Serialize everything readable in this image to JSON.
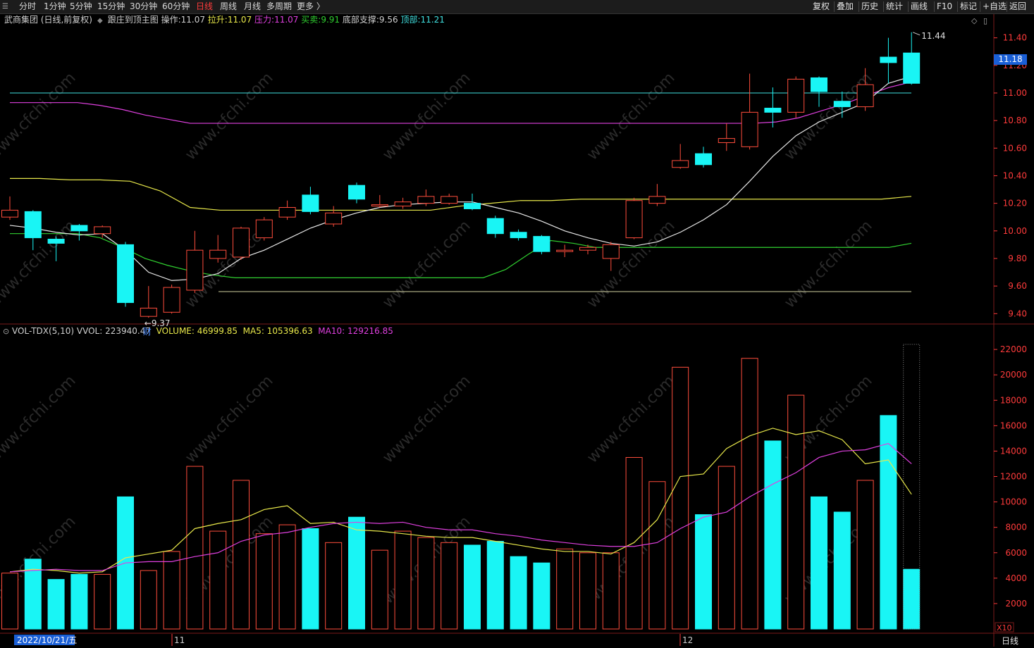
{
  "toolbar": {
    "app_icon": "menu-icon",
    "periods": [
      {
        "label": "分时"
      },
      {
        "label": "1分钟"
      },
      {
        "label": "5分钟"
      },
      {
        "label": "15分钟"
      },
      {
        "label": "30分钟"
      },
      {
        "label": "60分钟"
      },
      {
        "label": "日线",
        "active": true
      },
      {
        "label": "周线"
      },
      {
        "label": "月线"
      },
      {
        "label": "多周期"
      },
      {
        "label": "更多 〉"
      }
    ],
    "right_buttons": [
      {
        "label": "复权"
      },
      {
        "label": "叠加"
      },
      {
        "label": "历史"
      },
      {
        "label": "统计"
      },
      {
        "label": "画线"
      },
      {
        "label": "F10"
      },
      {
        "label": "标记"
      },
      {
        "label": "+自选"
      },
      {
        "label": "返回"
      }
    ]
  },
  "main_info": {
    "stock": "武商集团 (日线,前复权)",
    "indicator": "跟庄到顶主图",
    "op_label": "操作:",
    "op_value": "11.07",
    "lashen_label": "拉升:",
    "lashen_value": "11.07",
    "yali_label": "压力:",
    "yali_value": "11.07",
    "maimai_label": "买卖:",
    "maimai_value": "9.91",
    "dibu_label": "底部支撑:",
    "dibu_value": "9.56",
    "dingbu_label": "顶部:",
    "dingbu_value": "11.21"
  },
  "vol_info": {
    "name": "VOL-TDX(5,10)",
    "vvol": "VVOL: 223940.47",
    "volume": "VOLUME: 46999.85",
    "ma5": "MA5: 105396.63",
    "ma10": "MA10: 129216.85"
  },
  "price_axis": {
    "ticks": [
      "11.40",
      "11.20",
      "11.00",
      "10.80",
      "10.60",
      "10.40",
      "10.20",
      "10.00",
      "9.80",
      "9.60",
      "9.40"
    ],
    "current": "11.18"
  },
  "vol_axis": {
    "ticks": [
      "22000",
      "20000",
      "18000",
      "16000",
      "14000",
      "12000",
      "10000",
      "8000",
      "6000",
      "4000",
      "2000"
    ],
    "unit": "X10"
  },
  "annotations": {
    "high": "11.44",
    "low": "9.37",
    "cai": "财"
  },
  "date_bar": {
    "date": "2022/10/21/五",
    "month1": "11",
    "month2": "12",
    "period": "日线"
  },
  "watermark": "www.cfchi.com",
  "colors": {
    "up": "#ff4d3c",
    "down": "#19f5f5",
    "ma_white": "#e8e8e8",
    "yellow": "#e8e84a",
    "magenta": "#e040e0",
    "green": "#30d030",
    "cyan_line": "#40e0e0",
    "axis_red": "#ff3b3b"
  },
  "chart_data": {
    "type": "candlestick",
    "candles": [
      {
        "o": 10.1,
        "c": 10.15,
        "h": 10.25,
        "l": 10.08
      },
      {
        "o": 10.14,
        "c": 9.95,
        "h": 10.15,
        "l": 9.86
      },
      {
        "o": 9.94,
        "c": 9.91,
        "h": 9.96,
        "l": 9.78
      },
      {
        "o": 10.04,
        "c": 10.0,
        "h": 10.05,
        "l": 9.93
      },
      {
        "o": 9.98,
        "c": 10.03,
        "h": 10.04,
        "l": 9.95
      },
      {
        "o": 9.9,
        "c": 9.48,
        "h": 9.92,
        "l": 9.45
      },
      {
        "o": 9.38,
        "c": 9.44,
        "h": 9.6,
        "l": 9.37
      },
      {
        "o": 9.41,
        "c": 9.59,
        "h": 9.61,
        "l": 9.4
      },
      {
        "o": 9.57,
        "c": 9.86,
        "h": 10.0,
        "l": 9.55
      },
      {
        "o": 9.8,
        "c": 9.86,
        "h": 9.97,
        "l": 9.77
      },
      {
        "o": 9.81,
        "c": 10.02,
        "h": 10.03,
        "l": 9.79
      },
      {
        "o": 9.95,
        "c": 10.08,
        "h": 10.1,
        "l": 9.93
      },
      {
        "o": 10.1,
        "c": 10.17,
        "h": 10.22,
        "l": 10.08
      },
      {
        "o": 10.26,
        "c": 10.14,
        "h": 10.32,
        "l": 10.12
      },
      {
        "o": 10.05,
        "c": 10.13,
        "h": 10.18,
        "l": 10.03
      },
      {
        "o": 10.33,
        "c": 10.23,
        "h": 10.35,
        "l": 10.2
      },
      {
        "o": 10.18,
        "c": 10.19,
        "h": 10.26,
        "l": 10.17
      },
      {
        "o": 10.18,
        "c": 10.21,
        "h": 10.24,
        "l": 10.16
      },
      {
        "o": 10.2,
        "c": 10.25,
        "h": 10.3,
        "l": 10.18
      },
      {
        "o": 10.2,
        "c": 10.25,
        "h": 10.27,
        "l": 10.19
      },
      {
        "o": 10.2,
        "c": 10.16,
        "h": 10.27,
        "l": 10.15
      },
      {
        "o": 10.09,
        "c": 9.98,
        "h": 10.11,
        "l": 9.95
      },
      {
        "o": 9.99,
        "c": 9.95,
        "h": 10.01,
        "l": 9.93
      },
      {
        "o": 9.96,
        "c": 9.85,
        "h": 9.97,
        "l": 9.83
      },
      {
        "o": 9.85,
        "c": 9.86,
        "h": 9.9,
        "l": 9.81
      },
      {
        "o": 9.86,
        "c": 9.88,
        "h": 9.9,
        "l": 9.83
      },
      {
        "o": 9.8,
        "c": 9.9,
        "h": 9.92,
        "l": 9.71
      },
      {
        "o": 9.95,
        "c": 10.22,
        "h": 10.24,
        "l": 9.94
      },
      {
        "o": 10.2,
        "c": 10.25,
        "h": 10.34,
        "l": 10.18
      },
      {
        "o": 10.46,
        "c": 10.51,
        "h": 10.63,
        "l": 10.45
      },
      {
        "o": 10.56,
        "c": 10.48,
        "h": 10.61,
        "l": 10.46
      },
      {
        "o": 10.64,
        "c": 10.67,
        "h": 10.78,
        "l": 10.58
      },
      {
        "o": 10.61,
        "c": 10.86,
        "h": 11.14,
        "l": 10.59
      },
      {
        "o": 10.89,
        "c": 10.86,
        "h": 11.04,
        "l": 10.75
      },
      {
        "o": 10.86,
        "c": 11.1,
        "h": 11.12,
        "l": 10.82
      },
      {
        "o": 11.11,
        "c": 11.01,
        "h": 11.12,
        "l": 10.9
      },
      {
        "o": 10.94,
        "c": 10.9,
        "h": 11.01,
        "l": 10.82
      },
      {
        "o": 10.9,
        "c": 11.06,
        "h": 11.18,
        "l": 10.87
      },
      {
        "o": 11.26,
        "c": 11.22,
        "h": 11.4,
        "l": 11.07
      },
      {
        "o": 11.29,
        "c": 11.07,
        "h": 11.44,
        "l": 11.06
      }
    ],
    "volume": [
      4400,
      5500,
      3900,
      4300,
      4300,
      10400,
      4600,
      6100,
      12800,
      7700,
      11700,
      7500,
      8200,
      7900,
      6800,
      8800,
      6200,
      7700,
      7200,
      6800,
      6600,
      6900,
      5700,
      5200,
      6300,
      6000,
      6000,
      13500,
      11600,
      20600,
      9000,
      12800,
      21300,
      14800,
      18400,
      10400,
      9200,
      11700,
      16800,
      4700
    ],
    "volume_max_bar": 22400,
    "ma_price_white": [
      10.04,
      10.02,
      9.99,
      9.97,
      9.98,
      9.86,
      9.7,
      9.64,
      9.65,
      9.69,
      9.8,
      9.86,
      9.94,
      10.02,
      10.08,
      10.13,
      10.17,
      10.19,
      10.2,
      10.21,
      10.21,
      10.17,
      10.13,
      10.07,
      10.0,
      9.95,
      9.91,
      9.89,
      9.92,
      9.99,
      10.08,
      10.19,
      10.36,
      10.54,
      10.69,
      10.79,
      10.86,
      10.93,
      11.07,
      11.12
    ],
    "line_yellow": [
      10.38,
      10.38,
      10.37,
      10.37,
      10.36,
      10.29,
      10.17,
      10.15,
      10.15,
      10.15,
      10.15,
      10.15,
      10.15,
      10.15,
      10.15,
      10.18,
      10.2,
      10.22,
      10.22,
      10.23,
      10.23,
      10.23,
      10.23,
      10.23,
      10.23,
      10.23,
      10.23,
      10.23,
      10.23,
      10.23,
      10.25
    ],
    "line_magenta": [
      10.93,
      10.93,
      10.93,
      10.93,
      10.91,
      10.88,
      10.84,
      10.81,
      10.78,
      10.78,
      10.78,
      10.78,
      10.78,
      10.78,
      10.78,
      10.78,
      10.78,
      10.78,
      10.78,
      10.78,
      10.78,
      10.78,
      10.78,
      10.78,
      10.78,
      10.78,
      10.78,
      10.78,
      10.78,
      10.78,
      10.78,
      10.78,
      10.78,
      10.78,
      10.79,
      10.82,
      10.87,
      10.92,
      10.98,
      11.04,
      11.08
    ],
    "line_green": [
      9.98,
      9.98,
      9.98,
      9.98,
      9.95,
      9.88,
      9.8,
      9.75,
      9.71,
      9.68,
      9.66,
      9.66,
      9.66,
      9.66,
      9.66,
      9.66,
      9.66,
      9.66,
      9.66,
      9.66,
      9.66,
      9.66,
      9.72,
      9.83,
      9.93,
      9.91,
      9.88,
      9.88,
      9.88,
      9.88,
      9.88,
      9.88,
      9.88,
      9.88,
      9.88,
      9.88,
      9.88,
      9.88,
      9.88,
      9.88,
      9.91
    ],
    "hline_cyan": 11.0,
    "hline_white": 9.56,
    "vol_ma5": [
      4500,
      4700,
      4600,
      4400,
      4500,
      5600,
      5900,
      6200,
      7900,
      8300,
      8600,
      9400,
      9700,
      8300,
      8400,
      7800,
      7700,
      7500,
      7300,
      7200,
      7200,
      6900,
      6600,
      6300,
      6100,
      6100,
      5900,
      6800,
      8600,
      12000,
      12200,
      14200,
      15200,
      15800,
      15300,
      15600,
      14900,
      13000,
      13300,
      10600
    ],
    "vol_ma10": [
      4500,
      4600,
      4700,
      4600,
      4600,
      5200,
      5300,
      5300,
      5700,
      6000,
      6900,
      7400,
      7600,
      8000,
      8300,
      8400,
      8300,
      8400,
      8000,
      7800,
      7800,
      7500,
      7300,
      7000,
      6800,
      6600,
      6500,
      6500,
      6800,
      7900,
      8800,
      9200,
      10400,
      11400,
      12300,
      13500,
      14000,
      14100,
      14600,
      13000
    ]
  }
}
